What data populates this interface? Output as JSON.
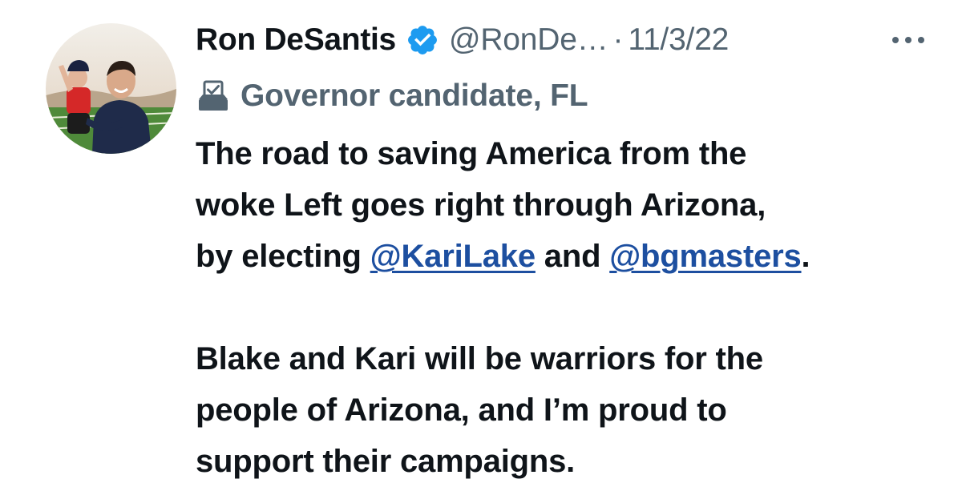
{
  "tweet": {
    "author": {
      "display_name": "Ron DeSantis",
      "handle": "@RonDe…",
      "verified": true,
      "avatar_icon": "profile-photo"
    },
    "separator": "·",
    "date": "11/3/22",
    "affiliation": {
      "icon": "ballot-box-icon",
      "label": "Governor candidate, FL"
    },
    "more_icon": "more-options-icon",
    "body": {
      "line1": "The road to saving America from the",
      "line2": "woke Left goes right through Arizona,",
      "line3_before": "by electing ",
      "mention1": "@KariLake",
      "line3_middle": " and ",
      "mention2": "@bgmasters",
      "line3_after": ".",
      "line4": "Blake and Kari will be warriors for the",
      "line5": "people of Arizona, and I’m proud to",
      "line6": "support their campaigns."
    }
  },
  "colors": {
    "text_primary": "#0f1419",
    "text_secondary": "#536471",
    "link": "#1d4fa0",
    "verified_badge": "#1d9bf0"
  }
}
